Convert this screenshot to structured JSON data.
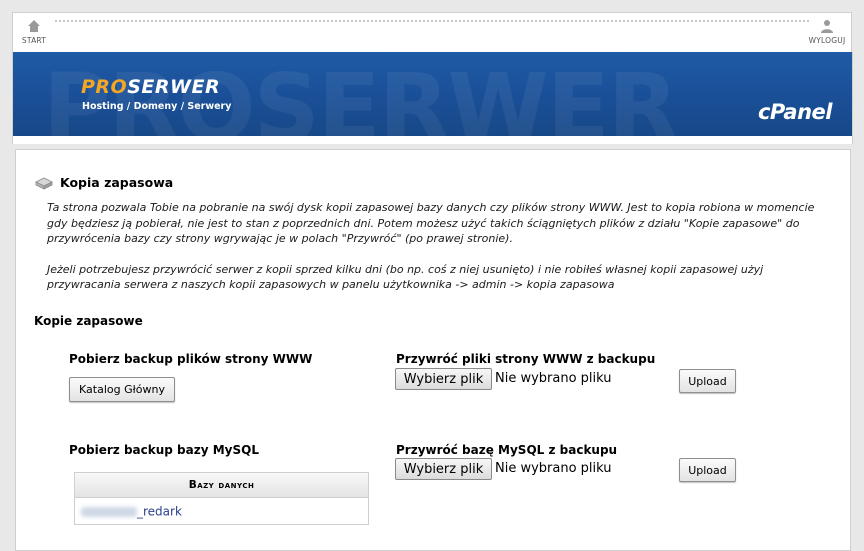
{
  "nav": {
    "start_label": "START",
    "logout_label": "WYLOGUJ"
  },
  "banner": {
    "watermark": "PROSERWER",
    "brand_pro": "PRO",
    "brand_serwer": "SERWER",
    "tagline": "Hosting / Domeny / Serwery",
    "cpanel": "cPanel"
  },
  "page": {
    "title": "Kopia zapasowa",
    "description_1": "Ta strona pozwala Tobie na pobranie na swój dysk kopii zapasowej bazy danych czy plików strony WWW. Jest to kopia robiona w momencie gdy będziesz ją pobierał, nie jest to stan z poprzednich dni. Potem możesz użyć takich ściągniętych plików z działu \"Kopie zapasowe\" do przywrócenia bazy czy strony wgrywając je w polach \"Przywróć\" (po prawej stronie).",
    "description_2": "Jeżeli potrzebujesz przywrócić serwer z kopii sprzed kilku dni (bo np. coś z niej usunięto) i nie robiłeś własnej kopii zapasowej użyj przywracania serwera z naszych kopii zapasowych w panelu użytkownika -> admin -> kopia zapasowa",
    "section_title": "Kopie zapasowe"
  },
  "files": {
    "download_heading": "Pobierz backup plików strony WWW",
    "home_dir_button": "Katalog Główny",
    "restore_heading": "Przywróć pliki strony WWW z backupu",
    "choose_file": "Wybierz plik",
    "no_file": "Nie wybrano pliku",
    "upload": "Upload"
  },
  "mysql": {
    "download_heading": "Pobierz backup bazy MySQL",
    "restore_heading": "Przywróć bazę MySQL z backupu",
    "choose_file": "Wybierz plik",
    "no_file": "Nie wybrano pliku",
    "upload": "Upload",
    "table_header": "Bazy danych",
    "databases": [
      {
        "name": "_redark"
      }
    ]
  },
  "colors": {
    "banner_blue": "#1a4f97",
    "brand_orange": "#f5a623",
    "link_blue": "#2a3f8f"
  }
}
